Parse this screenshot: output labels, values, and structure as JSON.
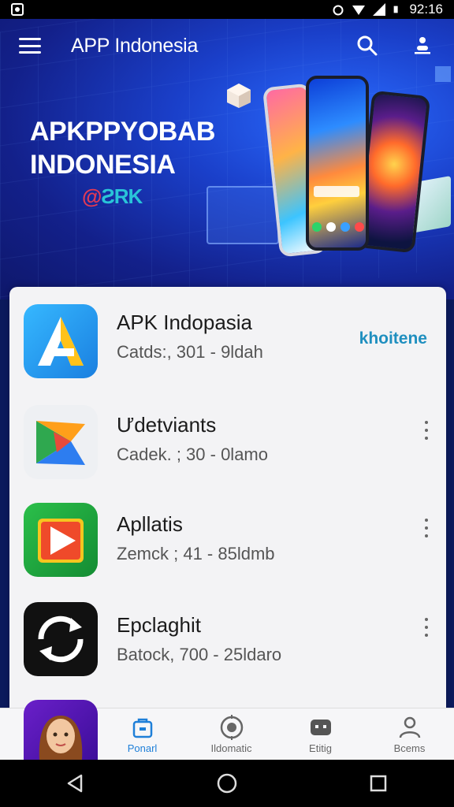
{
  "status_bar": {
    "time": "92:16"
  },
  "app_bar": {
    "title": "APP Indonesia"
  },
  "hero": {
    "title_line1": "APKPPYOBAB",
    "title_line2": "INDONESIA",
    "brand_at": "@",
    "brand_rest": "ƧRK"
  },
  "apps": [
    {
      "name": "APK Indopasia",
      "meta": "Catds:, 301 - 9ldah",
      "action": "khoitene"
    },
    {
      "name": "Ưdetviants",
      "meta": "Cadek. ; 30 - 0lamo"
    },
    {
      "name": "Apllatis",
      "meta": "Zemck ; 41 - 85ldmb"
    },
    {
      "name": "Epclaghit",
      "meta": "Batock, 700 - 25ldaro"
    }
  ],
  "bottom_nav": [
    {
      "label": "Ponarl",
      "active": true
    },
    {
      "label": "Ildomatic",
      "active": false
    },
    {
      "label": "Etitig",
      "active": false
    },
    {
      "label": "Bcems",
      "active": false
    }
  ],
  "colors": {
    "accent": "#1e7fd8",
    "hero_bg": "#1a3fc9",
    "action_text": "#1f8fbf"
  }
}
